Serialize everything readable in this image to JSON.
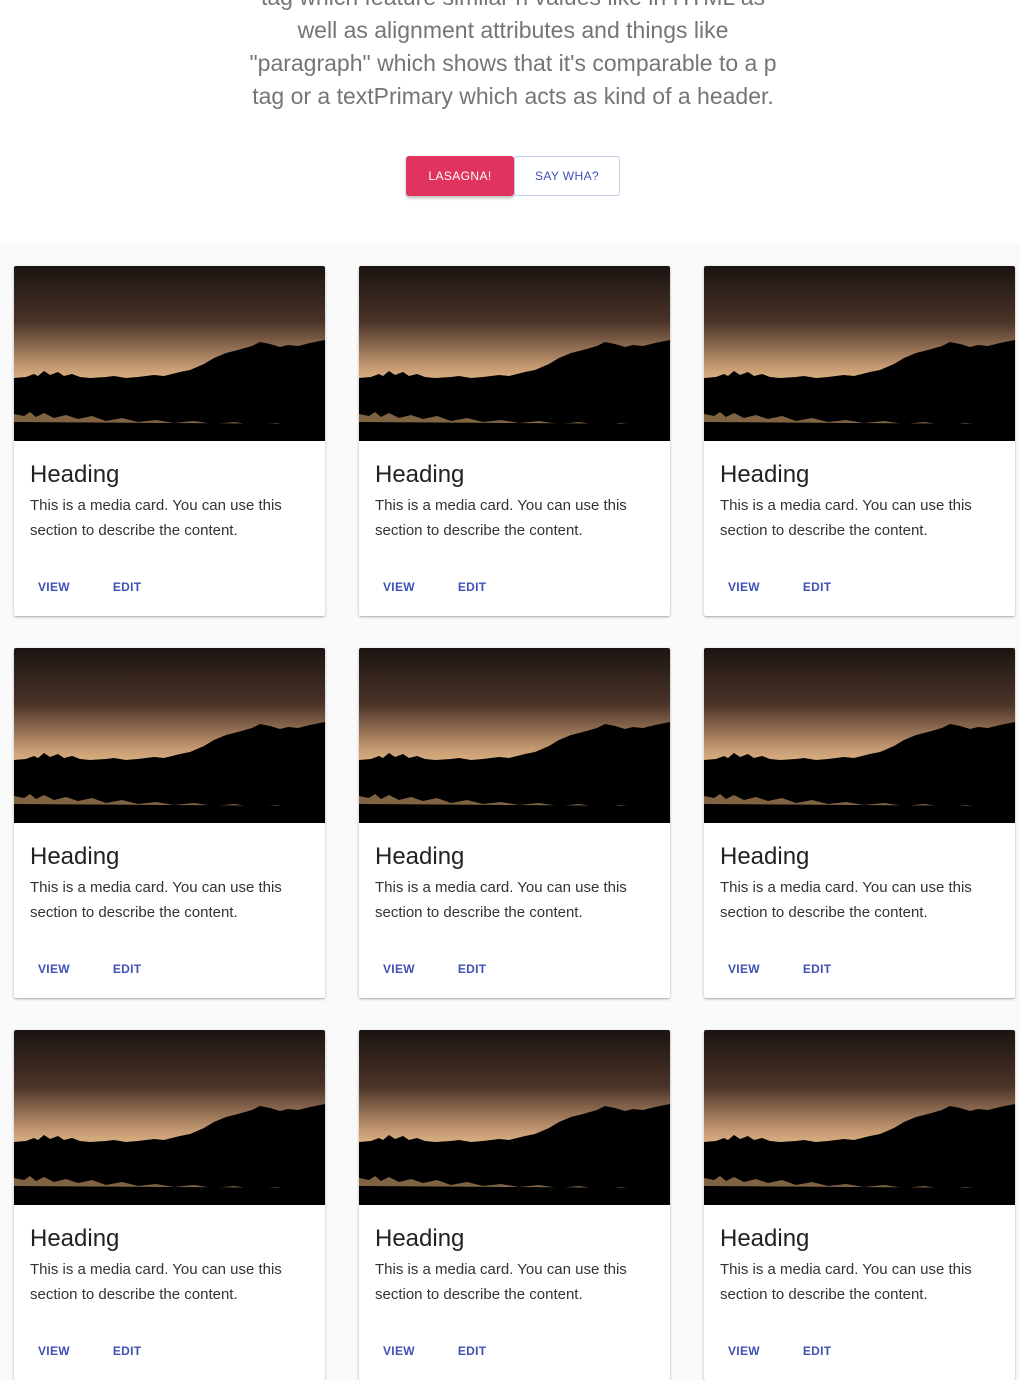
{
  "hero": {
    "lines": [
      "tag which feature similar h values like in HTML as",
      "well as alignment attributes and things like",
      "\"paragraph\" which shows that it's comparable to a p",
      "tag or a textPrimary which acts as kind of a header."
    ],
    "primary_button": "Lasagna!",
    "secondary_button": "Say wha?"
  },
  "colors": {
    "primary": "#e0345f",
    "accent": "#3f51b5",
    "hero_text": "#757575"
  },
  "cards": [
    {
      "heading": "Heading",
      "description": "This is a media card. You can use this section to describe the content.",
      "view_label": "View",
      "edit_label": "Edit"
    },
    {
      "heading": "Heading",
      "description": "This is a media card. You can use this section to describe the content.",
      "view_label": "View",
      "edit_label": "Edit"
    },
    {
      "heading": "Heading",
      "description": "This is a media card. You can use this section to describe the content.",
      "view_label": "View",
      "edit_label": "Edit"
    },
    {
      "heading": "Heading",
      "description": "This is a media card. You can use this section to describe the content.",
      "view_label": "View",
      "edit_label": "Edit"
    },
    {
      "heading": "Heading",
      "description": "This is a media card. You can use this section to describe the content.",
      "view_label": "View",
      "edit_label": "Edit"
    },
    {
      "heading": "Heading",
      "description": "This is a media card. You can use this section to describe the content.",
      "view_label": "View",
      "edit_label": "Edit"
    },
    {
      "heading": "Heading",
      "description": "This is a media card. You can use this section to describe the content.",
      "view_label": "View",
      "edit_label": "Edit"
    },
    {
      "heading": "Heading",
      "description": "This is a media card. You can use this section to describe the content.",
      "view_label": "View",
      "edit_label": "Edit"
    },
    {
      "heading": "Heading",
      "description": "This is a media card. You can use this section to describe the content.",
      "view_label": "View",
      "edit_label": "Edit"
    }
  ]
}
